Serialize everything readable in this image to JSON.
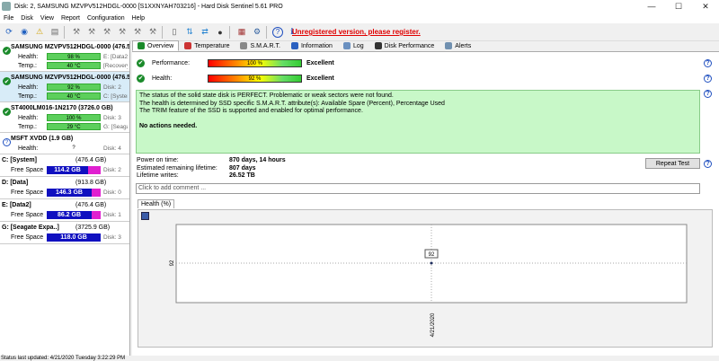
{
  "window": {
    "title": "Disk: 2, SAMSUNG MZVPV512HDGL-0000 [S1XXNYAH703216] - Hard Disk Sentinel 5.61 PRO",
    "minimize": "—",
    "maximize": "☐",
    "close": "✕"
  },
  "menu": [
    "File",
    "Disk",
    "View",
    "Report",
    "Configuration",
    "Help"
  ],
  "unregistered": "Unregistered version, please register.",
  "disks": [
    {
      "title": "SAMSUNG MZVPV512HDGL-0000 (476.5",
      "health": "98 %",
      "temp": "40 °C",
      "side1": "E: [Data2],",
      "side2": "[Recovery",
      "status": "ok"
    },
    {
      "title": "SAMSUNG MZVPV512HDGL-0000 (476.5",
      "health": "92 %",
      "temp": "40 °C",
      "side1": "Disk: 2",
      "side2": "C: [System",
      "status": "ok"
    },
    {
      "title": "ST4000LM016-1N2170 (3726.0 GB)",
      "health": "100 %",
      "temp": "29 °C",
      "side1": "Disk: 3",
      "side2": "G: [Seagat",
      "status": "ok"
    },
    {
      "title": "MSFT    XVDD (1.9 GB)",
      "health": "?",
      "temp": "",
      "side1": "Disk: 4",
      "side2": "",
      "status": "unknown"
    }
  ],
  "labels": {
    "health": "Health:",
    "temp": "Temp.:",
    "free_space": "Free Space",
    "performance": "Performance:",
    "health_right": "Health:"
  },
  "volumes": [
    {
      "name": "C: [System]",
      "size": "(476.4 GB)",
      "free": "114.2 GB",
      "disk": "Disk: 2"
    },
    {
      "name": "D: [Data]",
      "size": "(913.8 GB)",
      "free": "146.3 GB",
      "disk": "Disk: 0"
    },
    {
      "name": "E: [Data2]",
      "size": "(476.4 GB)",
      "free": "86.2 GB",
      "disk": "Disk: 1"
    },
    {
      "name": "G: [Seagate Expa..]",
      "size": "(3725.9 GB)",
      "free": "118.0 GB",
      "disk": "Disk: 3"
    }
  ],
  "tabs": [
    "Overview",
    "Temperature",
    "S.M.A.R.T.",
    "Information",
    "Log",
    "Disk Performance",
    "Alerts"
  ],
  "performance": {
    "value": "100 %",
    "grade": "Excellent"
  },
  "health": {
    "value": "92 %",
    "grade": "Excellent"
  },
  "status_text": [
    "The status of the solid state disk is PERFECT. Problematic or weak sectors were not found.",
    "The health is determined by SSD specific S.M.A.R.T. attribute(s):  Available Spare (Percent), Percentage Used",
    "The TRIM feature of the SSD is supported and enabled for optimal performance.",
    "",
    "No actions needed."
  ],
  "info": {
    "power_on_label": "Power on time:",
    "power_on_value": "870 days, 14 hours",
    "remaining_label": "Estimated remaining lifetime:",
    "remaining_value": "807 days",
    "writes_label": "Lifetime writes:",
    "writes_value": "26.52 TB"
  },
  "repeat_test": "Repeat Test",
  "comment_placeholder": "Click to add comment ...",
  "graph_tab": "Health (%)",
  "chart_data": {
    "type": "line",
    "x": [
      "4/21/2020"
    ],
    "values": [
      92
    ],
    "ytick": "92",
    "point_label": "92"
  },
  "status_bar": "Status last updated: 4/21/2020 Tuesday 3:22:29 PM"
}
